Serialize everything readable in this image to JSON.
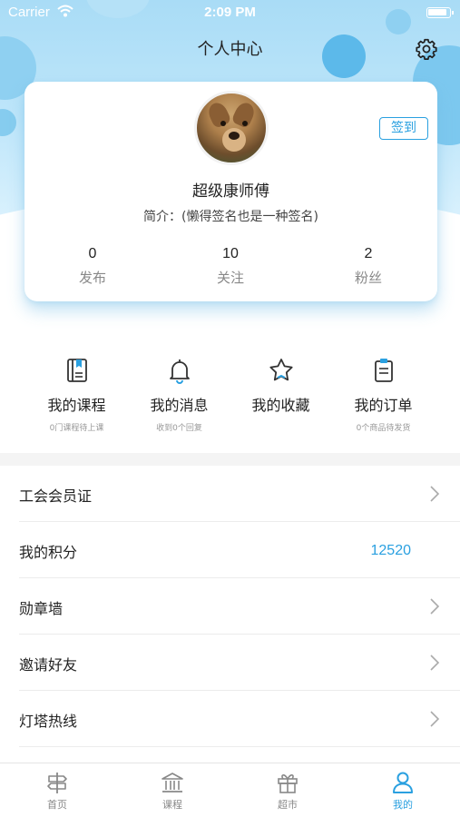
{
  "status_bar": {
    "carrier": "Carrier",
    "time": "2:09 PM"
  },
  "header": {
    "title": "个人中心",
    "settings_icon": "gear-icon"
  },
  "profile": {
    "name": "超级康师傅",
    "bio": "简介：(懒得签名也是一种签名)",
    "checkin_label": "签到",
    "stats": [
      {
        "value": "0",
        "label": "发布"
      },
      {
        "value": "10",
        "label": "关注"
      },
      {
        "value": "2",
        "label": "粉丝"
      }
    ]
  },
  "quick_actions": [
    {
      "icon": "book-icon",
      "label": "我的课程",
      "sub": "0门课程待上课"
    },
    {
      "icon": "bell-icon",
      "label": "我的消息",
      "sub": "收到0个回复"
    },
    {
      "icon": "star-icon",
      "label": "我的收藏",
      "sub": ""
    },
    {
      "icon": "clipboard-icon",
      "label": "我的订单",
      "sub": "0个商品待发货"
    }
  ],
  "menu": [
    {
      "label": "工会会员证"
    },
    {
      "label": "我的积分",
      "value": "12520"
    },
    {
      "label": "勋章墙"
    },
    {
      "label": "邀请好友"
    },
    {
      "label": "灯塔热线"
    }
  ],
  "tab_bar": [
    {
      "icon": "signpost-icon",
      "label": "首页"
    },
    {
      "icon": "classroom-icon",
      "label": "课程"
    },
    {
      "icon": "gift-icon",
      "label": "超市"
    },
    {
      "icon": "person-icon",
      "label": "我的",
      "active": true
    }
  ],
  "colors": {
    "accent": "#2aa0e0",
    "hero_bg": "#a9dcf6",
    "text": "#222222",
    "muted": "#888888"
  }
}
